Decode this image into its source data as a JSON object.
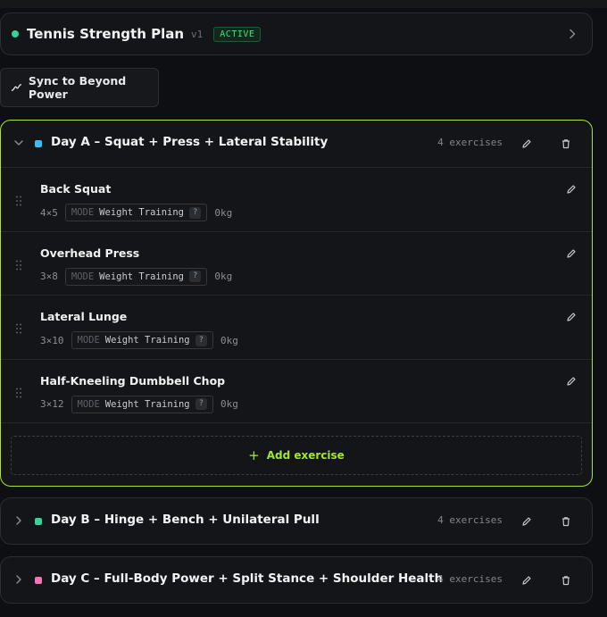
{
  "plan": {
    "title": "Tennis Strength Plan",
    "version": "v1",
    "status": "ACTIVE"
  },
  "sync": {
    "label": "Sync to Beyond Power"
  },
  "days": [
    {
      "title": "Day A – Squat + Press + Lateral Stability",
      "color": "#38bdf8",
      "count": "4 exercises",
      "expanded": true,
      "exercises": [
        {
          "name": "Back Squat",
          "scheme": "4×5",
          "mode_label": "MODE",
          "mode": "Weight Training",
          "help": "?",
          "weight": "0kg"
        },
        {
          "name": "Overhead Press",
          "scheme": "3×8",
          "mode_label": "MODE",
          "mode": "Weight Training",
          "help": "?",
          "weight": "0kg"
        },
        {
          "name": "Lateral Lunge",
          "scheme": "3×10",
          "mode_label": "MODE",
          "mode": "Weight Training",
          "help": "?",
          "weight": "0kg"
        },
        {
          "name": "Half-Kneeling Dumbbell Chop",
          "scheme": "3×12",
          "mode_label": "MODE",
          "mode": "Weight Training",
          "help": "?",
          "weight": "0kg"
        }
      ],
      "add_label": "Add exercise"
    },
    {
      "title": "Day B – Hinge + Bench + Unilateral Pull",
      "color": "#34d399",
      "count": "4 exercises",
      "expanded": false
    },
    {
      "title": "Day C – Full-Body Power + Split Stance + Shoulder Health",
      "color": "#f472b6",
      "count": "4 exercises",
      "expanded": false
    }
  ],
  "colors": {
    "accent": "#a3e635",
    "active_dot": "#34d399"
  }
}
